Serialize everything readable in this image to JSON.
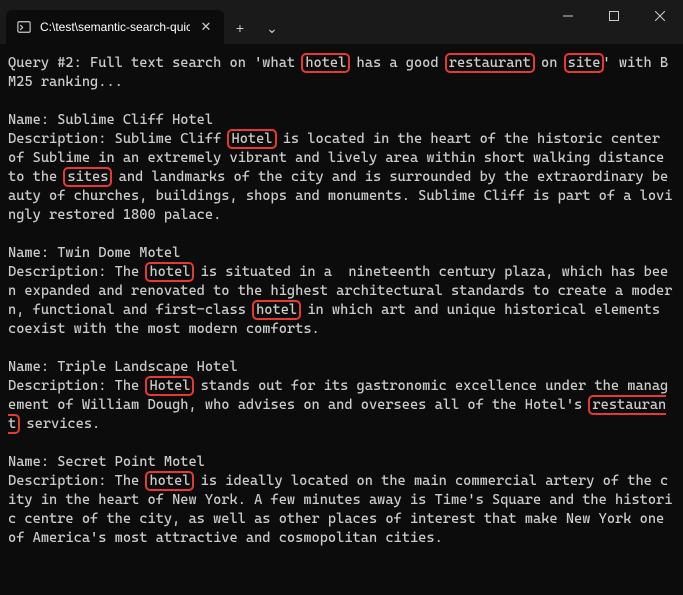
{
  "window": {
    "tab_title": "C:\\test\\semantic-search-quick",
    "tab_icon_glyph": "⧉",
    "close_glyph": "✕",
    "new_tab_glyph": "+",
    "dropdown_glyph": "⌄",
    "min_glyph": "—",
    "max_glyph": "▢",
    "winclose_glyph": "✕"
  },
  "query": {
    "prefix": "Query #2: Full text search on 'what ",
    "hl1": "hotel",
    "mid1": " has a good ",
    "hl2": "restaurant",
    "mid2": " on ",
    "hl3": "site",
    "suffix": "' with BM25 ranking..."
  },
  "results": [
    {
      "name_label": "Name: ",
      "name": "Sublime Cliff Hotel",
      "desc_segments": [
        {
          "t": "Description: Sublime Cliff "
        },
        {
          "t": "Hotel",
          "hl": true
        },
        {
          "t": " is located in the heart of the historic center of Sublime in an extremely vibrant and lively area within short walking distance to the "
        },
        {
          "t": "sites",
          "hl": true
        },
        {
          "t": " and landmarks of the city and is surrounded by the extraordinary beauty of churches, buildings, shops and monuments. Sublime Cliff is part of a lovingly restored 1800 palace."
        }
      ]
    },
    {
      "name_label": "Name: ",
      "name": "Twin Dome Motel",
      "desc_segments": [
        {
          "t": "Description: The "
        },
        {
          "t": "hotel",
          "hl": true
        },
        {
          "t": " is situated in a  nineteenth century plaza, which has been expanded and renovated to the highest architectural standards to create a modern, functional and first-class "
        },
        {
          "t": "hotel",
          "hl": true
        },
        {
          "t": " in which art and unique historical elements coexist with the most modern comforts."
        }
      ]
    },
    {
      "name_label": "Name: ",
      "name": "Triple Landscape Hotel",
      "desc_segments": [
        {
          "t": "Description: The "
        },
        {
          "t": "Hotel",
          "hl": true
        },
        {
          "t": " stands out for its gastronomic excellence under the management of William Dough, who advises on and oversees all of the Hotel's "
        },
        {
          "t": "restaurant",
          "hl": true
        },
        {
          "t": " services."
        }
      ]
    },
    {
      "name_label": "Name: ",
      "name": "Secret Point Motel",
      "desc_segments": [
        {
          "t": "Description: The "
        },
        {
          "t": "hotel",
          "hl": true
        },
        {
          "t": " is ideally located on the main commercial artery of the city in the heart of New York. A few minutes away is Time's Square and the historic centre of the city, as well as other places of interest that make New York one of America's most attractive and cosmopolitan cities."
        }
      ]
    }
  ]
}
